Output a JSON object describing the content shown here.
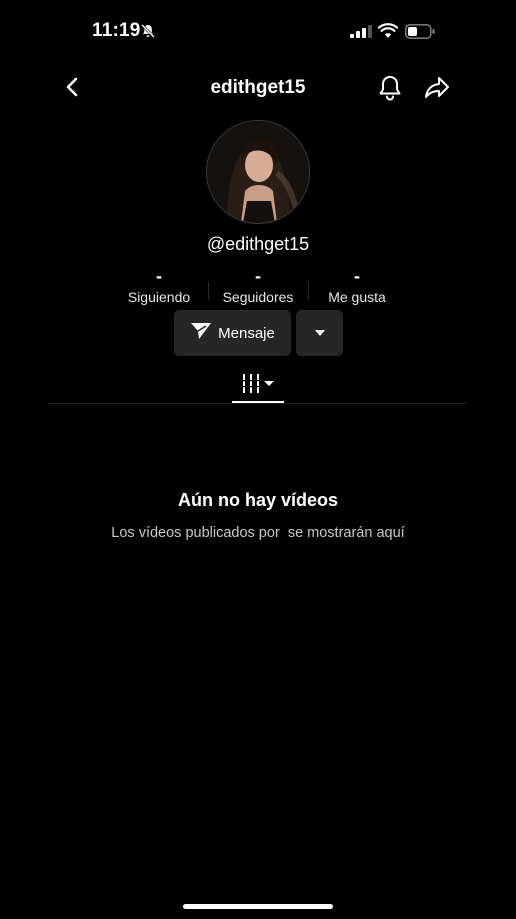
{
  "status_bar": {
    "time": "11:19",
    "icons": [
      "bell-muted-icon",
      "signal-icon",
      "wifi-icon",
      "battery-icon"
    ]
  },
  "header": {
    "title": "edithget15",
    "icons": [
      "back-icon",
      "bell-icon",
      "share-icon"
    ]
  },
  "profile": {
    "handle": "@edithget15",
    "stats": [
      {
        "value": "-",
        "label": "Siguiendo"
      },
      {
        "value": "-",
        "label": "Seguidores"
      },
      {
        "value": "-",
        "label": "Me gusta"
      }
    ],
    "message_button": "Mensaje"
  },
  "tabs": {
    "active_icon": "grid-icon"
  },
  "empty_state": {
    "title": "Aún no hay vídeos",
    "subtitle": "Los vídeos publicados por  se mostrarán aquí"
  },
  "colors": {
    "background": "#000000",
    "button_bg": "#262626",
    "text": "#ffffff"
  }
}
